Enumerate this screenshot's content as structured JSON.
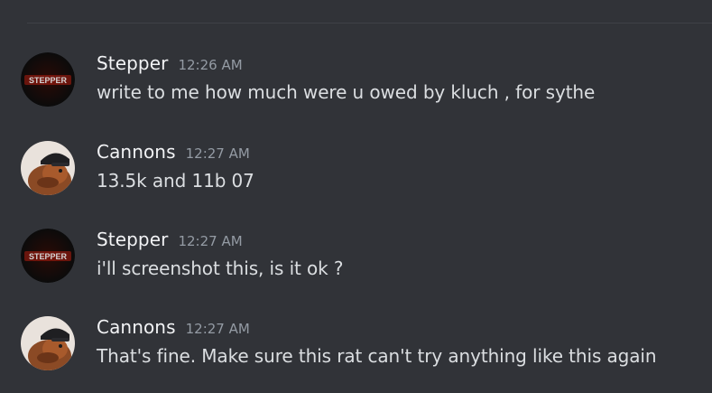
{
  "messages": [
    {
      "author": "Stepper",
      "timestamp": "12:26 AM",
      "text": "write to me how much were u owed by kluch , for sythe",
      "avatar": {
        "type": "logo",
        "logo_text": "STEPPER",
        "bg": "#0e0e0e",
        "text_color": "#c9c9c9",
        "glow": "#b21f10"
      }
    },
    {
      "author": "Cannons",
      "timestamp": "12:27 AM",
      "text": "13.5k and 11b 07",
      "avatar": {
        "type": "photo",
        "description_icon": "cat-with-cap-avatar-icon"
      }
    },
    {
      "author": "Stepper",
      "timestamp": "12:27 AM",
      "text": "i'll screenshot this, is it ok ?",
      "avatar": {
        "type": "logo",
        "logo_text": "STEPPER",
        "bg": "#0e0e0e",
        "text_color": "#c9c9c9",
        "glow": "#b21f10"
      }
    },
    {
      "author": "Cannons",
      "timestamp": "12:27 AM",
      "text": "That's fine. Make sure this rat can't try anything like this again",
      "avatar": {
        "type": "photo",
        "description_icon": "cat-with-cap-avatar-icon"
      }
    }
  ],
  "colors": {
    "background": "#313338",
    "author": "#f2f3f5",
    "timestamp": "#949ba4",
    "message_text": "#dbdee1"
  }
}
